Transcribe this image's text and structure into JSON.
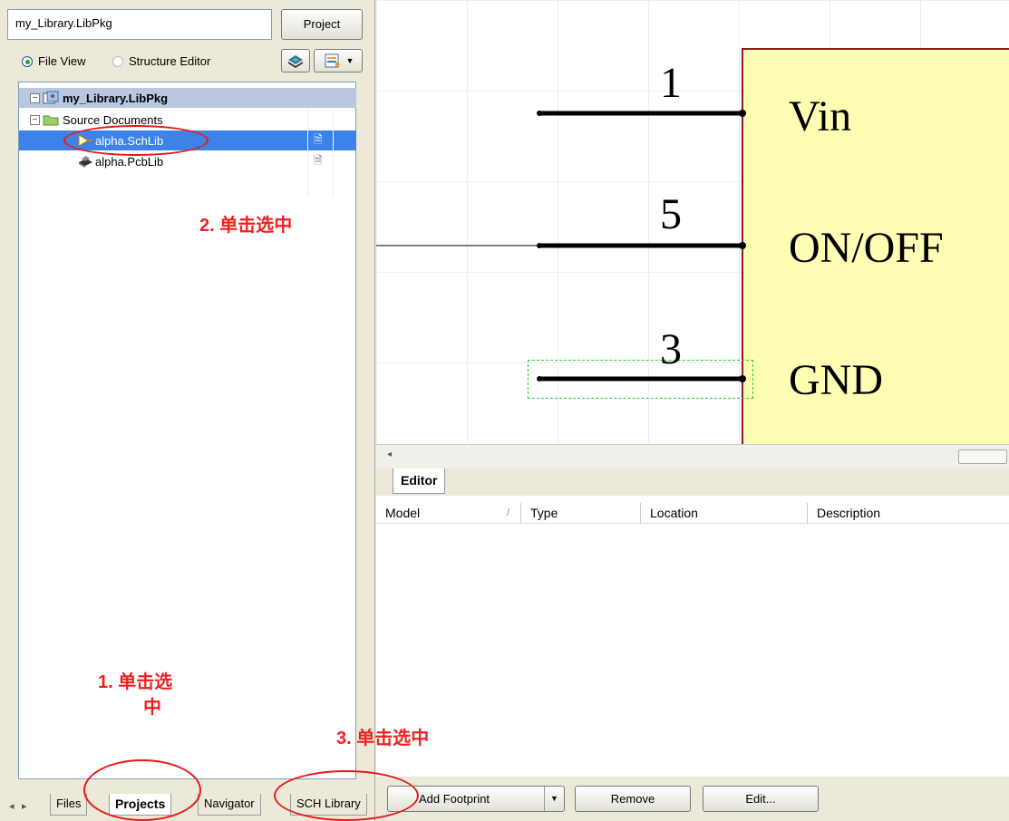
{
  "project_panel": {
    "project_name": "my_Library.LibPkg",
    "project_button": "Project",
    "view_options": [
      {
        "label": "File View",
        "checked": true
      },
      {
        "label": "Structure Editor",
        "checked": false
      }
    ],
    "tree": {
      "root": "my_Library.LibPkg",
      "folder": "Source Documents",
      "files": [
        {
          "name": "alpha.SchLib",
          "selected": true
        },
        {
          "name": "alpha.PcbLib",
          "selected": false
        }
      ]
    }
  },
  "bottom_tabs": [
    {
      "label": "Files",
      "active": false
    },
    {
      "label": "Projects",
      "active": true
    },
    {
      "label": "Navigator",
      "active": false
    },
    {
      "label": "SCH Library",
      "active": false
    }
  ],
  "schematic": {
    "pins": [
      {
        "number": "1",
        "name": "Vin"
      },
      {
        "number": "5",
        "name": "ON/OFF"
      },
      {
        "number": "3",
        "name": "GND"
      }
    ],
    "colors": {
      "body_fill": "#fdfdb4",
      "body_border": "#8b1a1a",
      "selection": "#2ec82e"
    }
  },
  "editor": {
    "tab": "Editor",
    "columns": [
      "Model",
      "Type",
      "Location",
      "Description"
    ],
    "buttons": {
      "add_footprint": "Add Footprint",
      "remove": "Remove",
      "edit": "Edit..."
    }
  },
  "annotations": {
    "step1_line1": "1. 单击选",
    "step1_line2": "中",
    "step2": "2. 单击选中",
    "step3": "3. 单击选中",
    "color": "#f02020"
  }
}
